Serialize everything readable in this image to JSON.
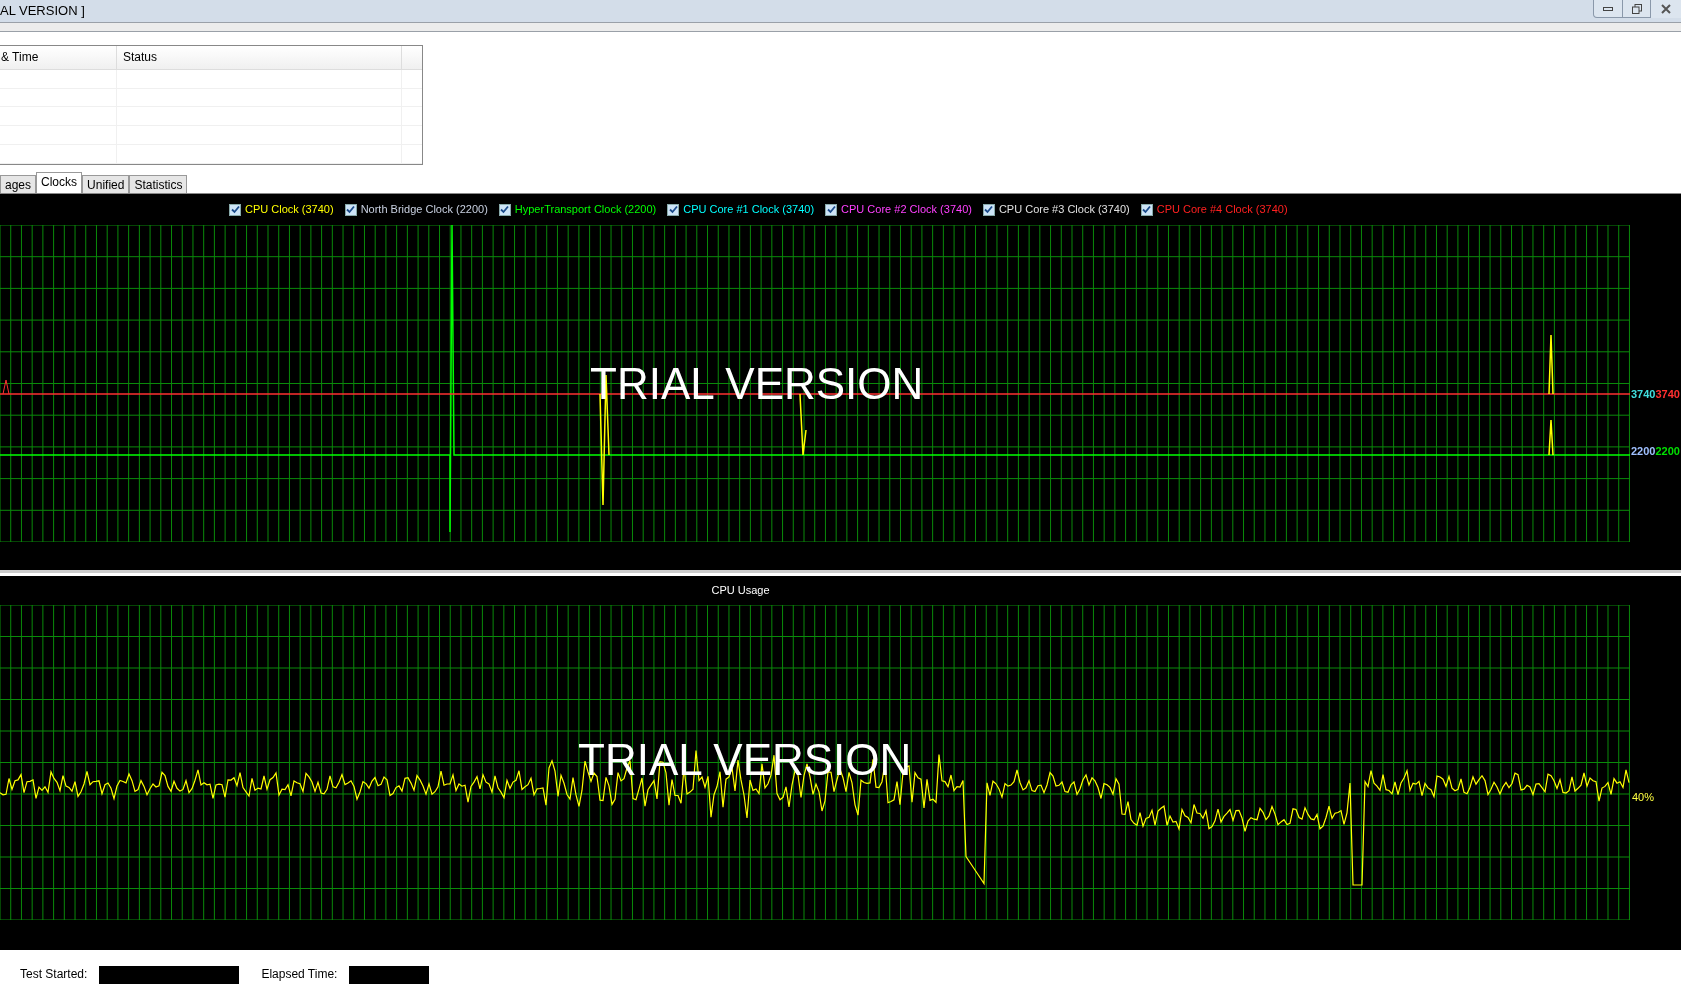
{
  "window": {
    "title": "AL VERSION ]"
  },
  "log_table": {
    "columns": [
      "& Time",
      "Status"
    ]
  },
  "tabs": [
    {
      "label": "ages",
      "selected": false
    },
    {
      "label": "Clocks",
      "selected": true
    },
    {
      "label": "Unified",
      "selected": false
    },
    {
      "label": "Statistics",
      "selected": false
    }
  ],
  "clock_chart": {
    "legend": [
      {
        "label": "CPU Clock (3740)",
        "checked": true,
        "color": "#ffff00"
      },
      {
        "label": "North Bridge Clock (2200)",
        "checked": true,
        "color": "#c8d0e0"
      },
      {
        "label": "HyperTransport Clock (2200)",
        "checked": true,
        "color": "#00ff00"
      },
      {
        "label": "CPU Core #1 Clock (3740)",
        "checked": true,
        "color": "#00ffff"
      },
      {
        "label": "CPU Core #2 Clock (3740)",
        "checked": true,
        "color": "#ff40ff"
      },
      {
        "label": "CPU Core #3 Clock (3740)",
        "checked": true,
        "color": "#e0e0e0"
      },
      {
        "label": "CPU Core #4 Clock (3740)",
        "checked": true,
        "color": "#ff2020"
      }
    ],
    "value_labels": [
      {
        "parts": [
          {
            "text": "3740",
            "color": "#40e0e0"
          },
          {
            "text": "3740",
            "color": "#ff3030"
          }
        ]
      },
      {
        "parts": [
          {
            "text": "2200",
            "color": "#a0c0ff"
          },
          {
            "text": "2200",
            "color": "#00e000"
          }
        ]
      }
    ],
    "overlay": "TRIAL VERSION"
  },
  "usage_chart": {
    "title": "CPU Usage",
    "value_label": "40%",
    "overlay": "TRIAL VERSION"
  },
  "footer": [
    {
      "label": "Test Started:"
    },
    {
      "label": "Elapsed Time:"
    }
  ]
}
